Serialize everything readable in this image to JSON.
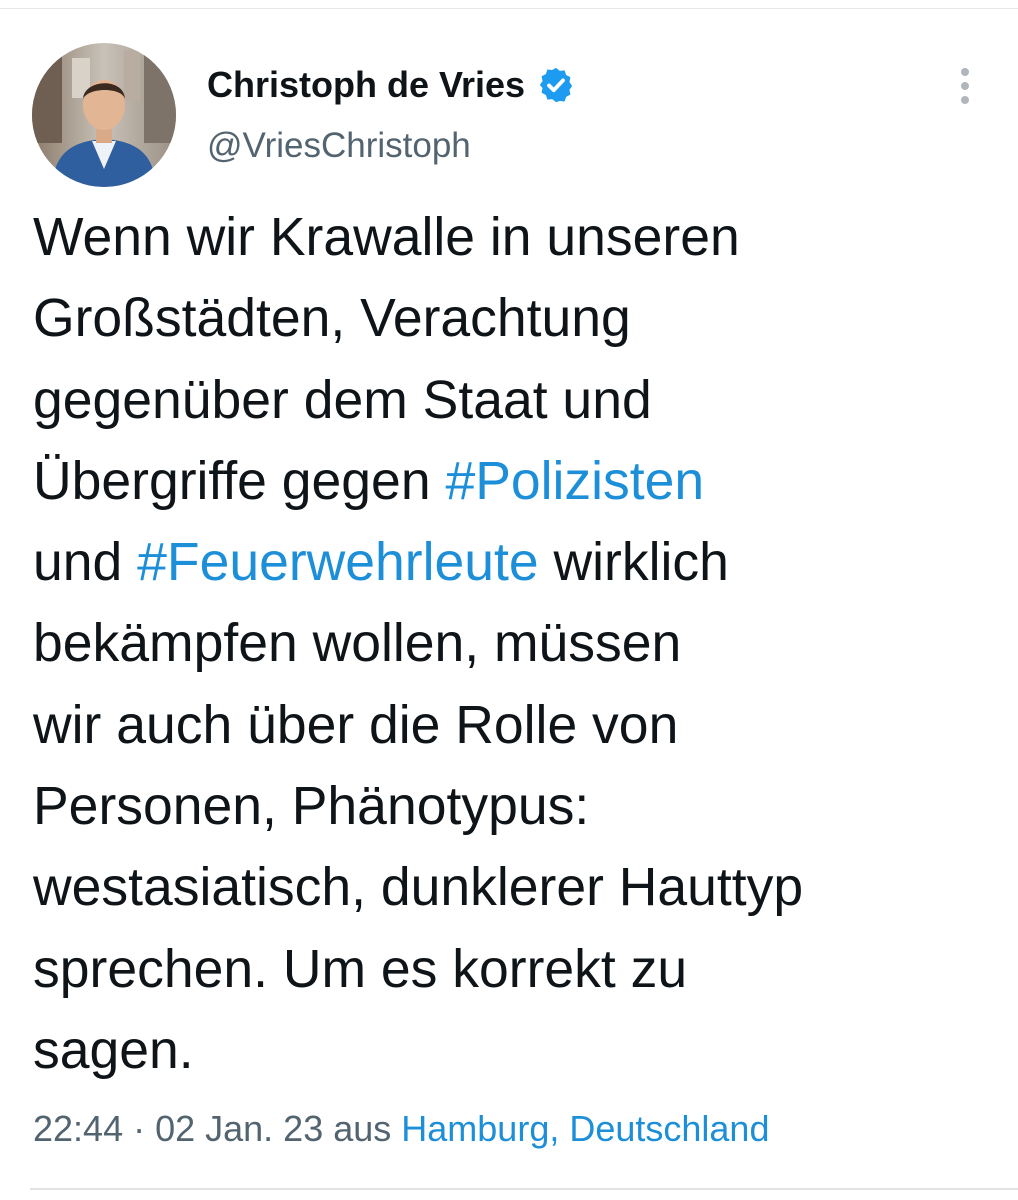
{
  "author": {
    "display_name": "Christoph de Vries",
    "handle": "@VriesChristoph",
    "verified": true,
    "verified_icon": "verified-badge-icon"
  },
  "menu": {
    "icon": "more-vertical-icon"
  },
  "tweet": {
    "lines": [
      [
        {
          "text": "Wenn wir Krawalle in unseren",
          "type": "text"
        }
      ],
      [
        {
          "text": "Großstädten, Verachtung",
          "type": "text"
        }
      ],
      [
        {
          "text": "gegenüber dem Staat und",
          "type": "text"
        }
      ],
      [
        {
          "text": "Übergriffe gegen ",
          "type": "text"
        },
        {
          "text": "#Polizisten",
          "type": "hashtag"
        }
      ],
      [
        {
          "text": "und ",
          "type": "text"
        },
        {
          "text": "#Feuerwehrleute",
          "type": "hashtag"
        },
        {
          "text": " wirklich",
          "type": "text"
        }
      ],
      [
        {
          "text": "bekämpfen wollen, müssen",
          "type": "text"
        }
      ],
      [
        {
          "text": "wir auch über die Rolle von",
          "type": "text"
        }
      ],
      [
        {
          "text": "Personen, Phänotypus:",
          "type": "text"
        }
      ],
      [
        {
          "text": "westasiatisch, dunklerer Hauttyp",
          "type": "text"
        }
      ],
      [
        {
          "text": "sprechen. Um es korrekt zu",
          "type": "text"
        }
      ],
      [
        {
          "text": "sagen.",
          "type": "text"
        }
      ]
    ]
  },
  "meta": {
    "time": "22:44",
    "separator": " · ",
    "date": "02 Jan. 23",
    "source_prefix": " aus ",
    "location": "Hamburg, Deutschland"
  },
  "colors": {
    "link": "#1d8fd8",
    "text": "#0f1419",
    "secondary": "#536471",
    "verified": "#1d9bf0"
  }
}
